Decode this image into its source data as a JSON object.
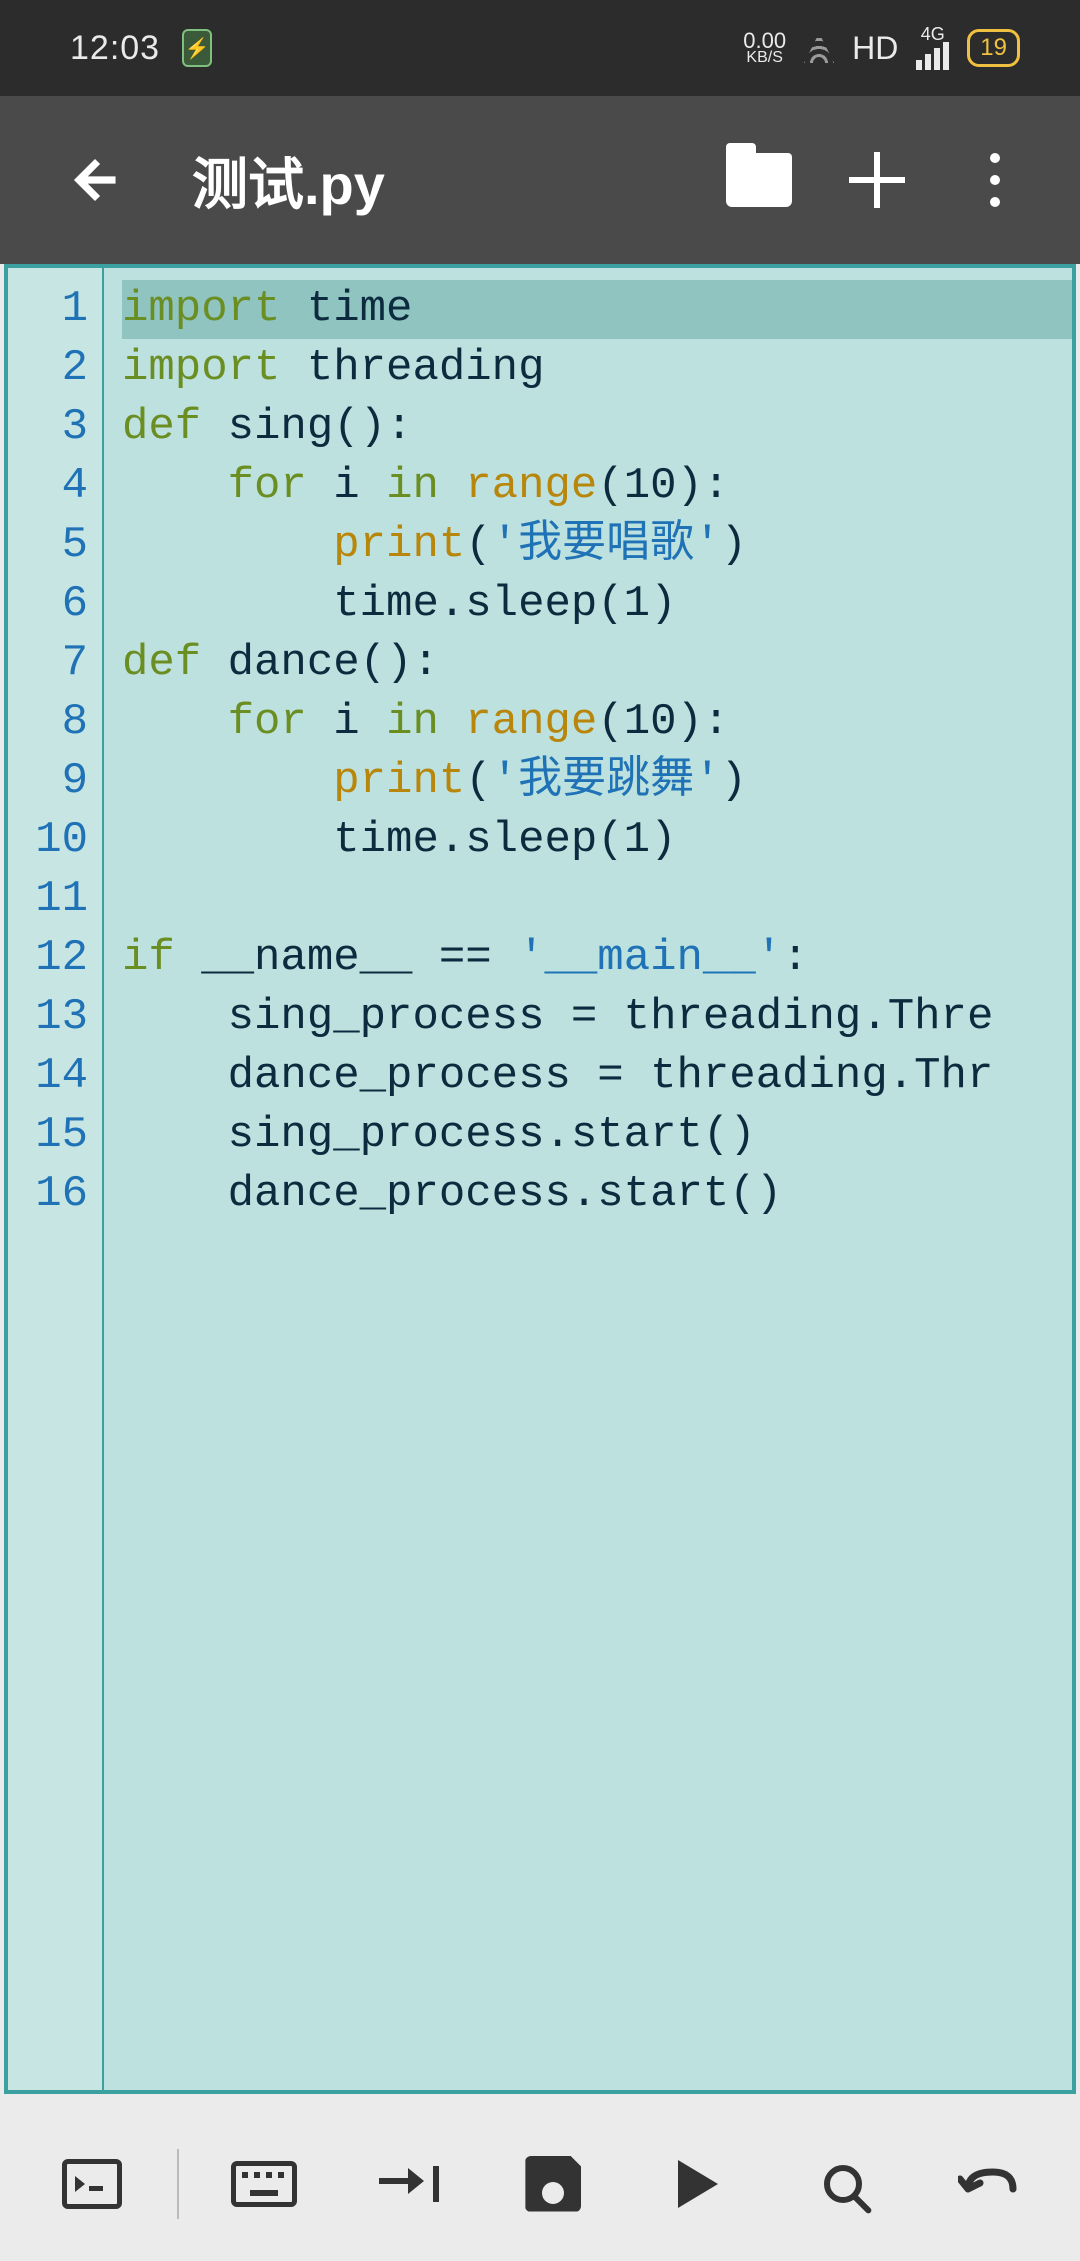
{
  "status": {
    "time": "12:03",
    "net_speed_value": "0.00",
    "net_speed_unit": "KB/S",
    "hd_label": "HD",
    "signal_label": "4G",
    "battery_percent": "19"
  },
  "appbar": {
    "filename": "测试.py"
  },
  "editor": {
    "highlighted_line": 1,
    "lines": [
      [
        [
          "kw",
          "import"
        ],
        [
          "default",
          " "
        ],
        [
          "default",
          "time"
        ]
      ],
      [
        [
          "kw",
          "import"
        ],
        [
          "default",
          " "
        ],
        [
          "default",
          "threading"
        ]
      ],
      [
        [
          "kw",
          "def"
        ],
        [
          "default",
          " sing():"
        ]
      ],
      [
        [
          "default",
          "    "
        ],
        [
          "kw",
          "for"
        ],
        [
          "default",
          " i "
        ],
        [
          "kw",
          "in"
        ],
        [
          "default",
          " "
        ],
        [
          "builtin",
          "range"
        ],
        [
          "default",
          "(10):"
        ]
      ],
      [
        [
          "default",
          "        "
        ],
        [
          "builtin",
          "print"
        ],
        [
          "default",
          "("
        ],
        [
          "str",
          "'我要唱歌'"
        ],
        [
          "default",
          ")"
        ]
      ],
      [
        [
          "default",
          "        time.sleep(1)"
        ]
      ],
      [
        [
          "kw",
          "def"
        ],
        [
          "default",
          " dance():"
        ]
      ],
      [
        [
          "default",
          "    "
        ],
        [
          "kw",
          "for"
        ],
        [
          "default",
          " i "
        ],
        [
          "kw",
          "in"
        ],
        [
          "default",
          " "
        ],
        [
          "builtin",
          "range"
        ],
        [
          "default",
          "(10):"
        ]
      ],
      [
        [
          "default",
          "        "
        ],
        [
          "builtin",
          "print"
        ],
        [
          "default",
          "("
        ],
        [
          "str",
          "'我要跳舞'"
        ],
        [
          "default",
          ")"
        ]
      ],
      [
        [
          "default",
          "        time.sleep(1)"
        ]
      ],
      [
        [
          "default",
          ""
        ]
      ],
      [
        [
          "kw",
          "if"
        ],
        [
          "default",
          " __name__ == "
        ],
        [
          "str",
          "'__main__'"
        ],
        [
          "default",
          ":"
        ]
      ],
      [
        [
          "default",
          "    sing_process = threading.Thre"
        ]
      ],
      [
        [
          "default",
          "    dance_process = threading.Thr"
        ]
      ],
      [
        [
          "default",
          "    sing_process.start()"
        ]
      ],
      [
        [
          "default",
          "    dance_process.start()"
        ]
      ]
    ]
  },
  "colors": {
    "editor_bg": "#bce1de",
    "editor_border": "#3aa0a0",
    "keyword": "#6b8e23",
    "builtin": "#b8860b",
    "string": "#1f72b5",
    "linenum": "#1f72b5"
  }
}
